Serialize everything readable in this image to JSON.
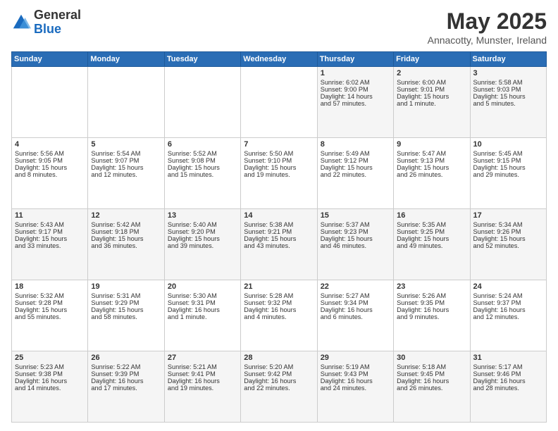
{
  "logo": {
    "general": "General",
    "blue": "Blue"
  },
  "title": "May 2025",
  "subtitle": "Annacotty, Munster, Ireland",
  "days_header": [
    "Sunday",
    "Monday",
    "Tuesday",
    "Wednesday",
    "Thursday",
    "Friday",
    "Saturday"
  ],
  "weeks": [
    [
      {
        "day": "",
        "content": ""
      },
      {
        "day": "",
        "content": ""
      },
      {
        "day": "",
        "content": ""
      },
      {
        "day": "",
        "content": ""
      },
      {
        "day": "1",
        "content": "Sunrise: 6:02 AM\nSunset: 9:00 PM\nDaylight: 14 hours\nand 57 minutes."
      },
      {
        "day": "2",
        "content": "Sunrise: 6:00 AM\nSunset: 9:01 PM\nDaylight: 15 hours\nand 1 minute."
      },
      {
        "day": "3",
        "content": "Sunrise: 5:58 AM\nSunset: 9:03 PM\nDaylight: 15 hours\nand 5 minutes."
      }
    ],
    [
      {
        "day": "4",
        "content": "Sunrise: 5:56 AM\nSunset: 9:05 PM\nDaylight: 15 hours\nand 8 minutes."
      },
      {
        "day": "5",
        "content": "Sunrise: 5:54 AM\nSunset: 9:07 PM\nDaylight: 15 hours\nand 12 minutes."
      },
      {
        "day": "6",
        "content": "Sunrise: 5:52 AM\nSunset: 9:08 PM\nDaylight: 15 hours\nand 15 minutes."
      },
      {
        "day": "7",
        "content": "Sunrise: 5:50 AM\nSunset: 9:10 PM\nDaylight: 15 hours\nand 19 minutes."
      },
      {
        "day": "8",
        "content": "Sunrise: 5:49 AM\nSunset: 9:12 PM\nDaylight: 15 hours\nand 22 minutes."
      },
      {
        "day": "9",
        "content": "Sunrise: 5:47 AM\nSunset: 9:13 PM\nDaylight: 15 hours\nand 26 minutes."
      },
      {
        "day": "10",
        "content": "Sunrise: 5:45 AM\nSunset: 9:15 PM\nDaylight: 15 hours\nand 29 minutes."
      }
    ],
    [
      {
        "day": "11",
        "content": "Sunrise: 5:43 AM\nSunset: 9:17 PM\nDaylight: 15 hours\nand 33 minutes."
      },
      {
        "day": "12",
        "content": "Sunrise: 5:42 AM\nSunset: 9:18 PM\nDaylight: 15 hours\nand 36 minutes."
      },
      {
        "day": "13",
        "content": "Sunrise: 5:40 AM\nSunset: 9:20 PM\nDaylight: 15 hours\nand 39 minutes."
      },
      {
        "day": "14",
        "content": "Sunrise: 5:38 AM\nSunset: 9:21 PM\nDaylight: 15 hours\nand 43 minutes."
      },
      {
        "day": "15",
        "content": "Sunrise: 5:37 AM\nSunset: 9:23 PM\nDaylight: 15 hours\nand 46 minutes."
      },
      {
        "day": "16",
        "content": "Sunrise: 5:35 AM\nSunset: 9:25 PM\nDaylight: 15 hours\nand 49 minutes."
      },
      {
        "day": "17",
        "content": "Sunrise: 5:34 AM\nSunset: 9:26 PM\nDaylight: 15 hours\nand 52 minutes."
      }
    ],
    [
      {
        "day": "18",
        "content": "Sunrise: 5:32 AM\nSunset: 9:28 PM\nDaylight: 15 hours\nand 55 minutes."
      },
      {
        "day": "19",
        "content": "Sunrise: 5:31 AM\nSunset: 9:29 PM\nDaylight: 15 hours\nand 58 minutes."
      },
      {
        "day": "20",
        "content": "Sunrise: 5:30 AM\nSunset: 9:31 PM\nDaylight: 16 hours\nand 1 minute."
      },
      {
        "day": "21",
        "content": "Sunrise: 5:28 AM\nSunset: 9:32 PM\nDaylight: 16 hours\nand 4 minutes."
      },
      {
        "day": "22",
        "content": "Sunrise: 5:27 AM\nSunset: 9:34 PM\nDaylight: 16 hours\nand 6 minutes."
      },
      {
        "day": "23",
        "content": "Sunrise: 5:26 AM\nSunset: 9:35 PM\nDaylight: 16 hours\nand 9 minutes."
      },
      {
        "day": "24",
        "content": "Sunrise: 5:24 AM\nSunset: 9:37 PM\nDaylight: 16 hours\nand 12 minutes."
      }
    ],
    [
      {
        "day": "25",
        "content": "Sunrise: 5:23 AM\nSunset: 9:38 PM\nDaylight: 16 hours\nand 14 minutes."
      },
      {
        "day": "26",
        "content": "Sunrise: 5:22 AM\nSunset: 9:39 PM\nDaylight: 16 hours\nand 17 minutes."
      },
      {
        "day": "27",
        "content": "Sunrise: 5:21 AM\nSunset: 9:41 PM\nDaylight: 16 hours\nand 19 minutes."
      },
      {
        "day": "28",
        "content": "Sunrise: 5:20 AM\nSunset: 9:42 PM\nDaylight: 16 hours\nand 22 minutes."
      },
      {
        "day": "29",
        "content": "Sunrise: 5:19 AM\nSunset: 9:43 PM\nDaylight: 16 hours\nand 24 minutes."
      },
      {
        "day": "30",
        "content": "Sunrise: 5:18 AM\nSunset: 9:45 PM\nDaylight: 16 hours\nand 26 minutes."
      },
      {
        "day": "31",
        "content": "Sunrise: 5:17 AM\nSunset: 9:46 PM\nDaylight: 16 hours\nand 28 minutes."
      }
    ]
  ]
}
